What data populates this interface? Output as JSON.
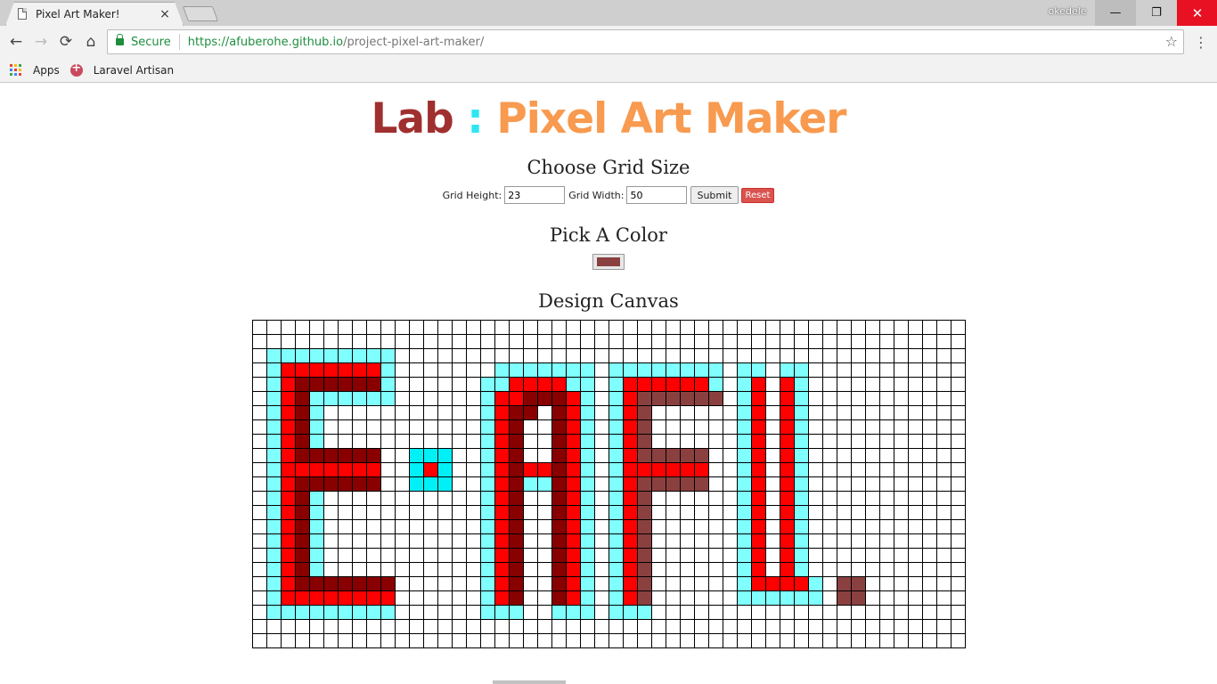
{
  "browser": {
    "tab_title": "Pixel Art Maker!",
    "tab_close": "×",
    "profile_name": "okedele",
    "secure_label": "Secure",
    "url_host": "https://afuberohe.github.io",
    "url_path": "/project-pixel-art-maker/",
    "bookmarks": [
      {
        "label": "Apps",
        "icon": "apps-grid-icon"
      },
      {
        "label": "Laravel Artisan",
        "icon": "laravel-icon"
      }
    ],
    "icons": {
      "back": "←",
      "forward": "→",
      "reload": "⟳",
      "home": "⌂",
      "star": "☆",
      "menu": "⋮",
      "minimize": "—",
      "maximize": "❐",
      "close": "✕"
    }
  },
  "page": {
    "heading_lab": "Lab",
    "heading_colon": ":",
    "heading_maker": "Pixel Art Maker",
    "grid_section_title": "Choose Grid Size",
    "grid_height_label": "Grid Height:",
    "grid_height_value": "23",
    "grid_width_label": "Grid Width:",
    "grid_width_value": "50",
    "submit_label": "Submit",
    "reset_label": "Reset",
    "color_section_title": "Pick A Color",
    "selected_color": "#8b4040",
    "canvas_section_title": "Design Canvas"
  },
  "canvas": {
    "rows": 23,
    "cols": 50,
    "palette": {
      "c": "#80ffff",
      "C": "#00f0f8",
      "r": "#ff0000",
      "d": "#880000",
      "b": "#8b4040"
    },
    "pixels": [
      "..................................................",
      "..................................................",
      ".ccccccccc........................................",
      ".crrrrrrrc.......ccccccc.cccccccc.cc.cc...........",
      ".crddddddc......ccrrrrcc.crrrrrrc.cr.rc...........",
      ".crdcccccc......crrdddrc.crbbbbbb.cr.rc...........",
      ".crdc...........crdd.drc.crb......cr.rc...........",
      ".crdc...........crd..drc.crb......cr.rc...........",
      ".crdc...........crd..drc.crb......cr.rc...........",
      ".crdddddd..CCC..crd..drc.crbbbbb..cr.rc...........",
      ".crrrrrrr..CrC..crdrrdrc.crrrrrr..cr.rc...........",
      ".crdddddd..CCC..crdccdrc.crbbbbb..cr.rc...........",
      ".crdc...........crd..drc.crb......cr.rc...........",
      ".crdc...........crd..drc.crb......cr.rc...........",
      ".crdc...........crd..drc.crb......cr.rc...........",
      ".crdc...........crd..drc.crb......cr.rc...........",
      ".crdc...........crd..drc.crb......cr.rc...........",
      ".crdc...........crd..drc.crb......cr.rc...........",
      ".crddddddd......crd..drc.crb......crrrrc.bb.......",
      ".crrrrrrrr......crd..drc.crb......cccccc.bb.......",
      ".ccccccccc......ccc..ccc.ccc.....................",
      "..................................................",
      ".................................................."
    ]
  }
}
